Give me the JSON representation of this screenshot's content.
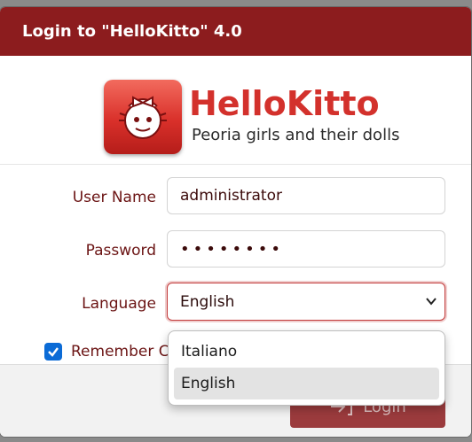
{
  "dialog": {
    "title": "Login to \"HelloKitto\" 4.0"
  },
  "logo": {
    "name": "HelloKitto",
    "tagline": "Peoria girls and their dolls"
  },
  "form": {
    "username_label": "User Name",
    "username_value": "administrator",
    "password_label": "Password",
    "password_value": "••••••••",
    "language_label": "Language",
    "language_value": "English",
    "remember_label": "Remember Credentials",
    "remember_checked": true
  },
  "language_dropdown": {
    "options": [
      "Italiano",
      "English"
    ],
    "highlighted_option": "English"
  },
  "footer": {
    "login_label": "Login",
    "login_icon": "login-arrow-icon"
  },
  "colors": {
    "title_bar": "#8c1c1e",
    "label_text": "#6b1414",
    "checkbox": "#0b6bd6"
  }
}
